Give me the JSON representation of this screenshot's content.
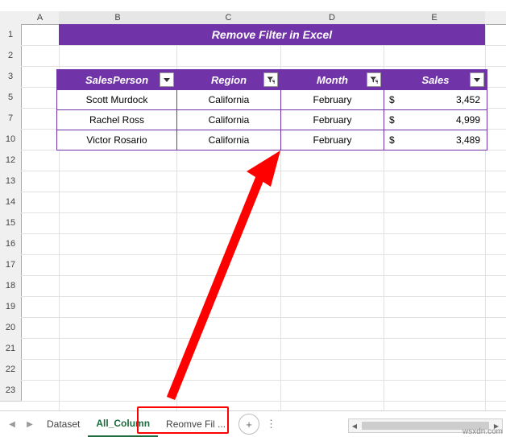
{
  "spreadsheet": {
    "column_headers": [
      "A",
      "B",
      "C",
      "D",
      "E"
    ],
    "row_headers": [
      "1",
      "2",
      "3",
      "5",
      "7",
      "10",
      "12",
      "13",
      "14",
      "15",
      "16",
      "17",
      "18",
      "19",
      "20",
      "21",
      "22",
      "23"
    ],
    "title_banner": "Remove Filter in Excel",
    "table": {
      "headers": [
        "SalesPerson",
        "Region",
        "Month",
        "Sales"
      ],
      "rows": [
        {
          "salesperson": "Scott Murdock",
          "region": "California",
          "month": "February",
          "currency": "$",
          "sales": "3,452"
        },
        {
          "salesperson": "Rachel Ross",
          "region": "California",
          "month": "February",
          "currency": "$",
          "sales": "4,999"
        },
        {
          "salesperson": "Victor Rosario",
          "region": "California",
          "month": "February",
          "currency": "$",
          "sales": "3,489"
        }
      ]
    },
    "header_accent_color": "#7134a8"
  },
  "tabbar": {
    "nav_first": "◀",
    "nav_prev": "▶",
    "sheets": [
      {
        "label": "Dataset",
        "active": false
      },
      {
        "label": "All_Column",
        "active": true
      },
      {
        "label": "Reomve Fil ...",
        "active": false
      }
    ],
    "add_sheet": "+",
    "more": "⋮",
    "scroll_left": "◀",
    "scroll_right": "▶"
  },
  "watermark": "wsxdn.com"
}
